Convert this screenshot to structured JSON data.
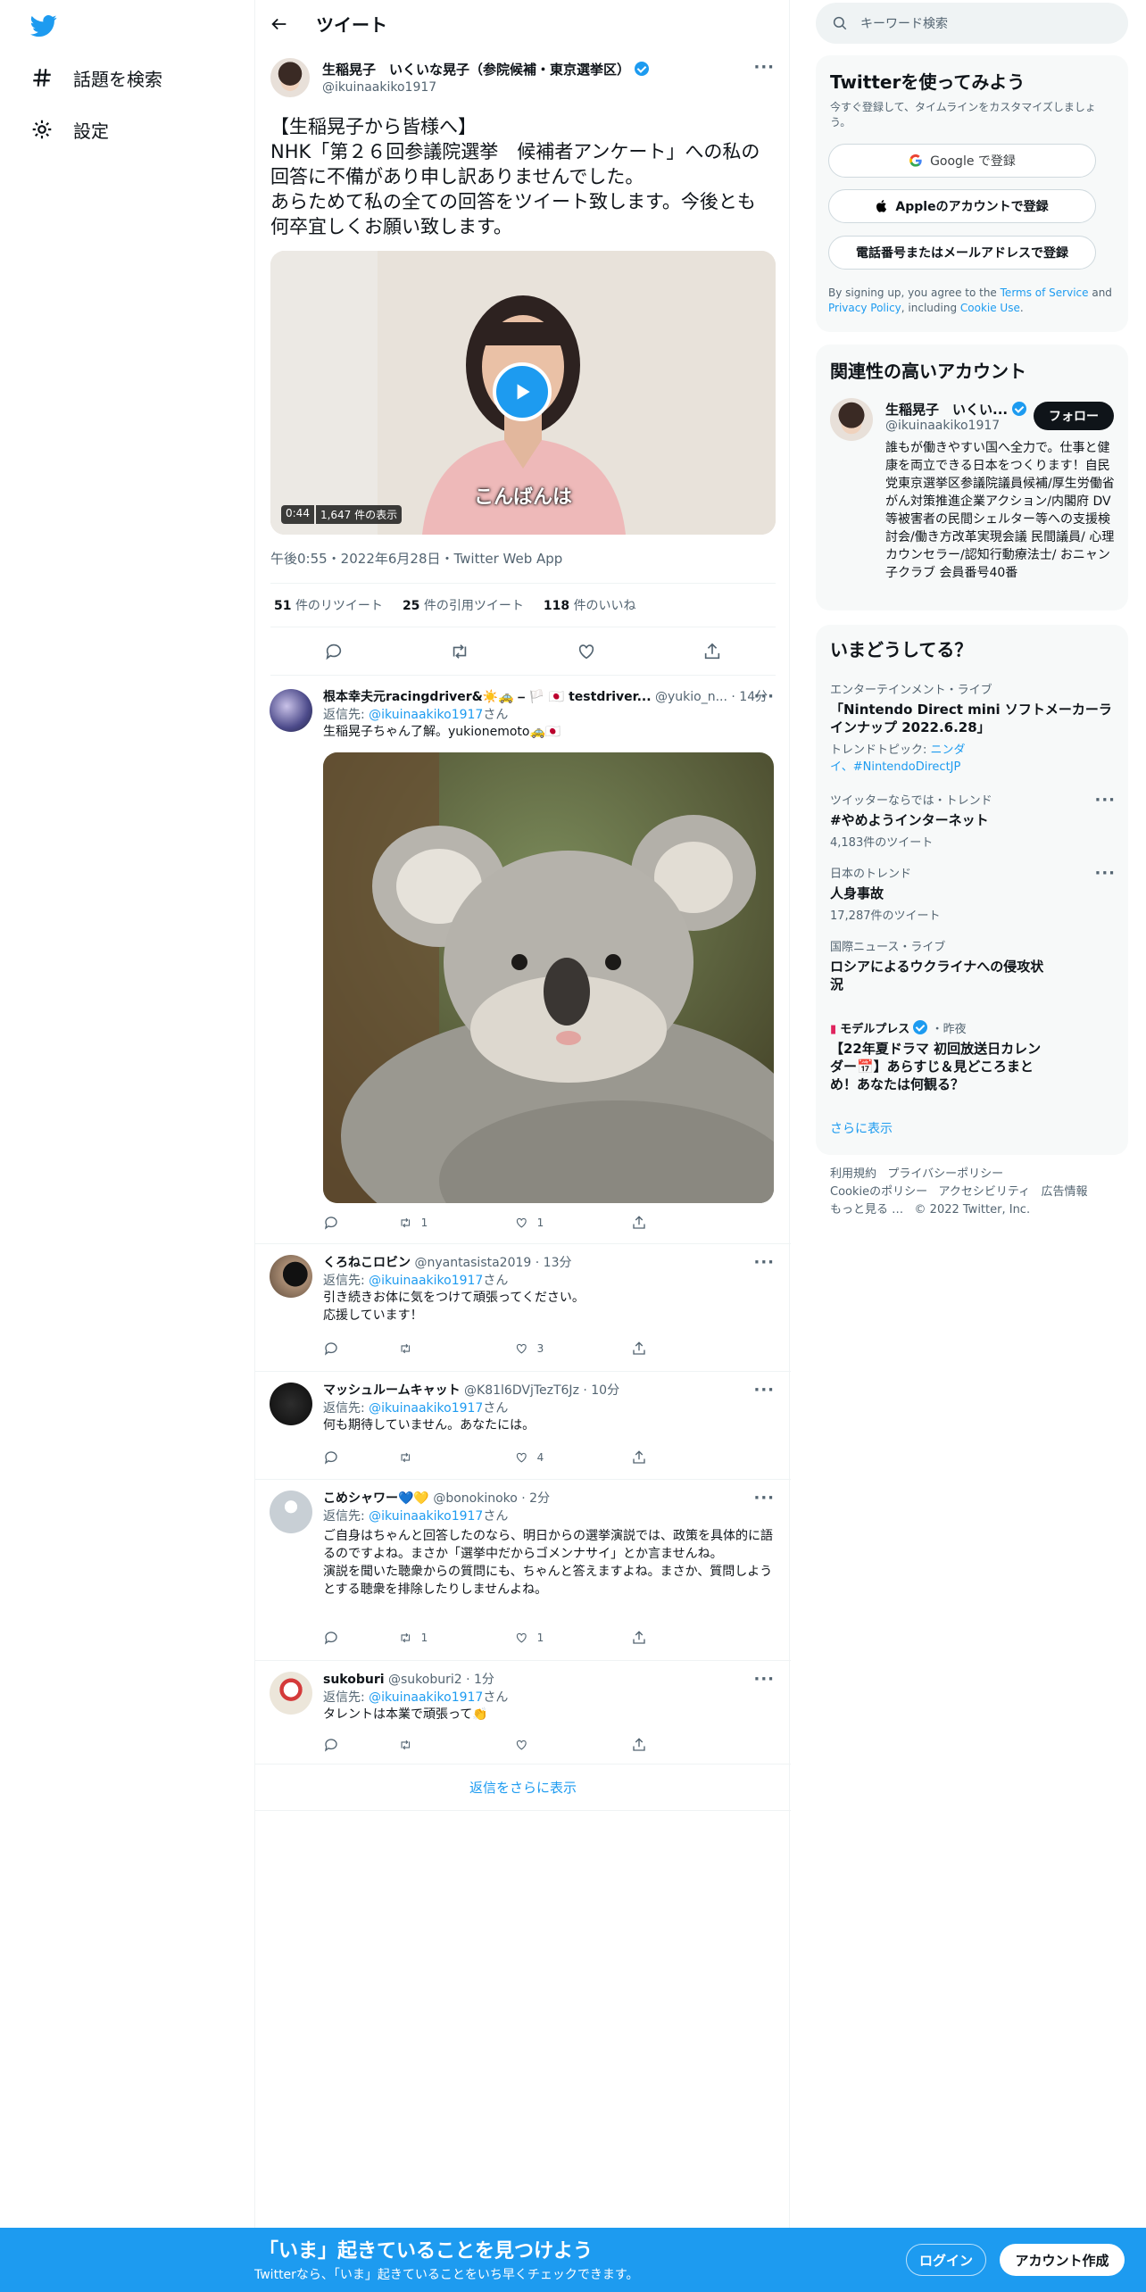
{
  "nav": {
    "explore_label": "話題を検索",
    "settings_label": "設定"
  },
  "header": {
    "title": "ツイート"
  },
  "tweet": {
    "author_name": "生稲晃子　いくいな晃子（参院候補・東京選挙区）",
    "author_handle": "@ikuinaakiko1917",
    "text": "【生稲晃子から皆様へ】\nNHK「第２６回参議院選挙　候補者アンケート」への私の回答に不備があり申し訳ありませんでした。\nあらためて私の全ての回答をツイート致します。今後とも何卒宜しくお願い致します。",
    "video": {
      "duration": "0:44",
      "views": "1,647 件の表示",
      "caption": "こんばんは"
    },
    "timestamp": "午後0:55・2022年6月28日・Twitter Web App",
    "stats": {
      "retweets": "51",
      "retweets_label": "件のリツイート",
      "quotes": "25",
      "quotes_label": "件の引用ツイート",
      "likes": "118",
      "likes_label": "件のいいね"
    }
  },
  "replies": [
    {
      "name": "根本幸夫元racingdriver&☀️🚕 ⎯ 🏳️ 🇯🇵 testdriver...",
      "handle": "@yukio_n...",
      "time": "· 14分",
      "reply_to_prefix": "返信先:",
      "reply_to": "@ikuinaakiko1917",
      "reply_to_suffix": "さん",
      "text": "生稲晃子ちゃん了解。yukionemoto🚕🇯🇵",
      "retweets": "1",
      "likes": "1"
    },
    {
      "name": "くろねこロビン",
      "handle": "@nyantasista2019",
      "time": "· 13分",
      "reply_to_prefix": "返信先:",
      "reply_to": "@ikuinaakiko1917",
      "reply_to_suffix": "さん",
      "text": "引き続きお体に気をつけて頑張ってください。\n応援しています！",
      "retweets": "",
      "likes": "3"
    },
    {
      "name": "マッシュルームキャット",
      "handle": "@K81l6DVjTezT6Jz",
      "time": "· 10分",
      "reply_to_prefix": "返信先:",
      "reply_to": "@ikuinaakiko1917",
      "reply_to_suffix": "さん",
      "text": "何も期待していません。あなたには。",
      "retweets": "",
      "likes": "4"
    },
    {
      "name": "こめシャワー💙💛",
      "handle": "@bonokinoko",
      "time": "· 2分",
      "reply_to_prefix": "返信先:",
      "reply_to": "@ikuinaakiko1917",
      "reply_to_suffix": "さん",
      "text": "ご自身はちゃんと回答したのなら、明日からの選挙演説では、政策を具体的に語るのですよね。まさか「選挙中だからゴメンナサイ」とか言ませんね。\n演説を聞いた聴衆からの質問にも、ちゃんと答えますよね。まさか、質問しようとする聴衆を排除したりしませんよね。",
      "retweets": "1",
      "likes": "1"
    },
    {
      "name": "sukoburi",
      "handle": "@sukoburi2",
      "time": "· 1分",
      "reply_to_prefix": "返信先:",
      "reply_to": "@ikuinaakiko1917",
      "reply_to_suffix": "さん",
      "text": "タレントは本業で頑張って👏",
      "retweets": "",
      "likes": ""
    }
  ],
  "show_more_replies": "返信をさらに表示",
  "search": {
    "placeholder": "キーワード検索"
  },
  "signup": {
    "title": "Twitterを使ってみよう",
    "subtitle": "今すぐ登録して、タイムラインをカスタマイズしましょう。",
    "google": "Google で登録",
    "apple": "Appleのアカウントで登録",
    "phone": "電話番号またはメールアドレスで登録",
    "legal_1": "By signing up, you agree to the ",
    "terms": "Terms of Service",
    "legal_2": " and ",
    "privacy": "Privacy Policy",
    "legal_3": ", including ",
    "cookie": "Cookie Use",
    "legal_4": "."
  },
  "relevant": {
    "title": "関連性の高いアカウント",
    "name": "生稲晃子　いくい...",
    "handle": "@ikuinaakiko1917",
    "follow": "フォロー",
    "bio": "誰もが働きやすい国へ全力で。仕事と健康を両立できる日本をつくります！自民党東京選挙区参議院議員候補/厚生労働省 がん対策推進企業アクション/内閣府 DV等被害者の民間シェルター等への支援検討会/働き方改革実現会議 民間議員/ 心理カウンセラー/認知行動療法士/ おニャン子クラブ 会員番号40番"
  },
  "trends": {
    "title": "いまどうしてる？",
    "items": [
      {
        "category": "エンターテインメント・ライブ",
        "title": "「Nintendo Direct mini ソフトメーカーラインナップ 2022.6.28」",
        "topic_prefix": "トレンドトピック: ",
        "topic": "ニンダイ、#NintendoDirectJP",
        "count": ""
      },
      {
        "category": "ツイッターならでは・トレンド",
        "title": "#やめようインターネット",
        "count": "4,183件のツイート"
      },
      {
        "category": "日本のトレンド",
        "title": "人身事故",
        "count": "17,287件のツイート"
      },
      {
        "category": "国際ニュース・ライブ",
        "title": "ロシアによるウクライナへの侵攻状況",
        "count": ""
      },
      {
        "category": "モデルプレス",
        "category_suffix": "・昨夜",
        "title": "【22年夏ドラマ 初回放送日カレンダー📅】あらすじ＆見どころまとめ！あなたは何観る？",
        "count": ""
      }
    ],
    "show_more": "さらに表示"
  },
  "footer": {
    "terms": "利用規約",
    "privacy": "プライバシーポリシー",
    "cookie": "Cookieのポリシー",
    "accessibility": "アクセシビリティ",
    "ads": "広告情報",
    "more": "もっと見る …",
    "copyright": "© 2022 Twitter, Inc."
  },
  "bottom": {
    "title": "「いま」起きていることを見つけよう",
    "subtitle": "Twitterなら、「いま」起きていることをいち早くチェックできます。",
    "login": "ログイン",
    "signup": "アカウント作成"
  }
}
